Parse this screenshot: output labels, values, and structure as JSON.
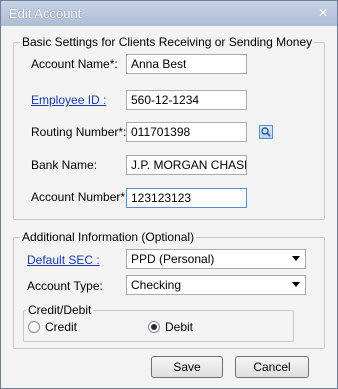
{
  "window": {
    "title": "Edit Account",
    "close_glyph": "✕"
  },
  "basic": {
    "title": "Basic Settings for Clients Receiving or Sending Money",
    "account_name_label": "Account Name*:",
    "account_name_value": "Anna Best",
    "employee_id_label": "Employee ID :",
    "employee_id_value": "560-12-1234",
    "routing_label": "Routing Number*:",
    "routing_value": "011701398",
    "bank_name_label": "Bank Name:",
    "bank_name_value": "J.P. MORGAN CHASE B",
    "account_number_label": "Account Number*:",
    "account_number_value": "123123123"
  },
  "additional": {
    "title": "Additional Information (Optional)",
    "default_sec_label": "Default SEC :",
    "default_sec_value": "PPD (Personal)",
    "account_type_label": "Account Type:",
    "account_type_value": "Checking",
    "credit_debit": {
      "title": "Credit/Debit",
      "credit_label": "Credit",
      "debit_label": "Debit",
      "selected": "Debit"
    }
  },
  "buttons": {
    "save": "Save",
    "cancel": "Cancel"
  },
  "colors": {
    "link": "#1a3aa8",
    "title_bar": "#aebdd6"
  },
  "icons": {
    "routing_lookup": "search-icon",
    "close": "close-icon"
  }
}
